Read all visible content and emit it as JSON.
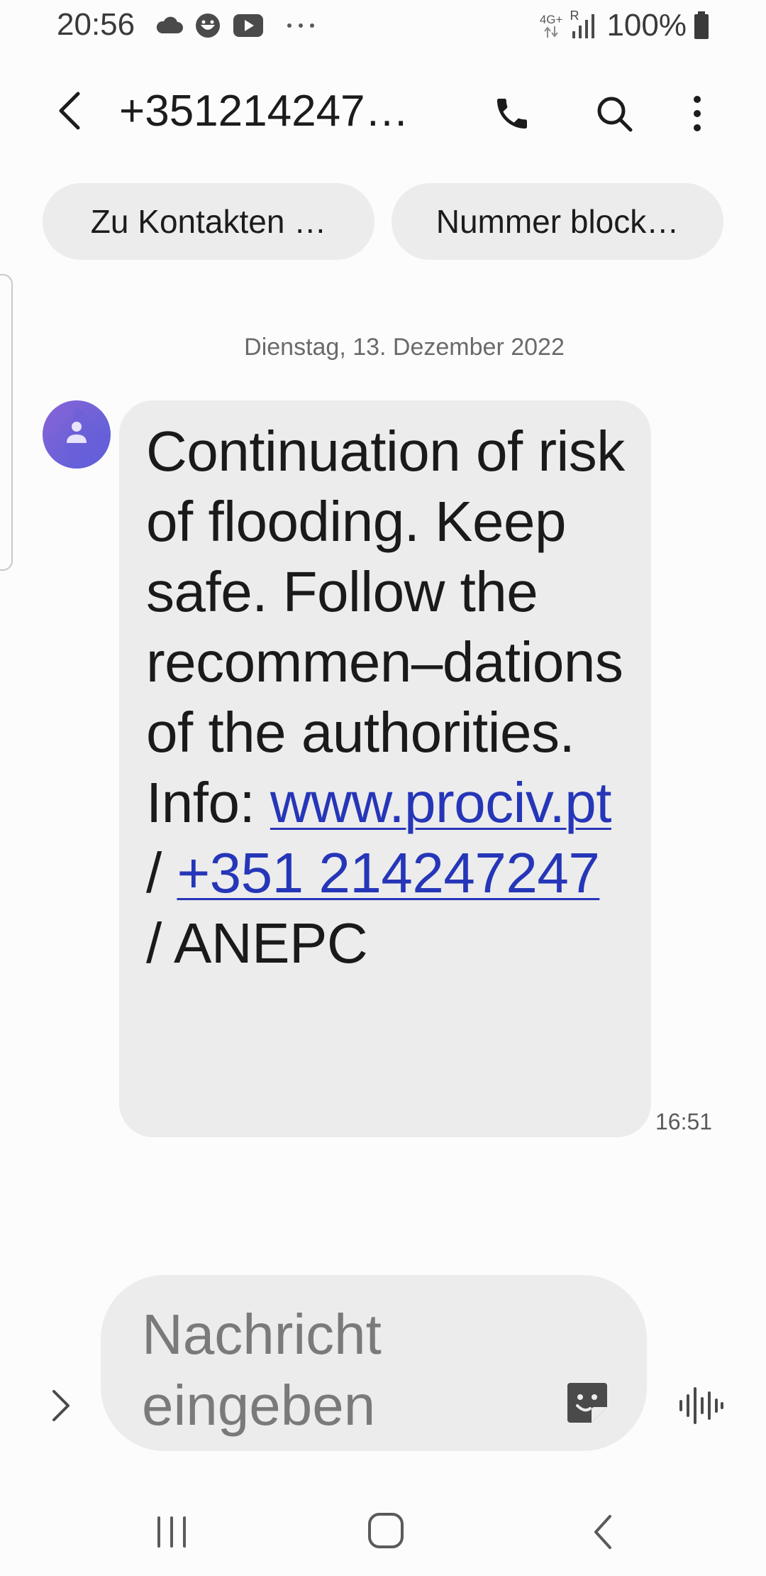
{
  "status_bar": {
    "time": "20:56",
    "icons_left": [
      "cloud-icon",
      "emoji-icon",
      "youtube-icon",
      "more-dots-icon"
    ],
    "network_type": "4G+",
    "roaming": "R",
    "battery": "100%"
  },
  "app_bar": {
    "contact": "+351214247…"
  },
  "chips": {
    "add_to_contacts": "Zu Kontakten …",
    "block_number": "Nummer block…"
  },
  "conversation": {
    "date": "Dienstag, 13. Dezember 2022",
    "message": {
      "text_before_link": "Continuation of risk of flooding. Keep safe. Follow the recommen–dations of the authorities. Info: ",
      "link_url": "www.prociv.pt",
      "separator_1": " / ",
      "link_phone": "+351 214247247",
      "separator_2": " / ",
      "sender": "ANEPC",
      "time": "16:51"
    }
  },
  "composer": {
    "placeholder": "Nachricht eingeben"
  },
  "colors": {
    "background": "#fcfcfc",
    "bubble": "#ececec",
    "link": "#2636b8",
    "avatar_gradient": [
      "#7f63d6",
      "#5b5fd8"
    ]
  }
}
